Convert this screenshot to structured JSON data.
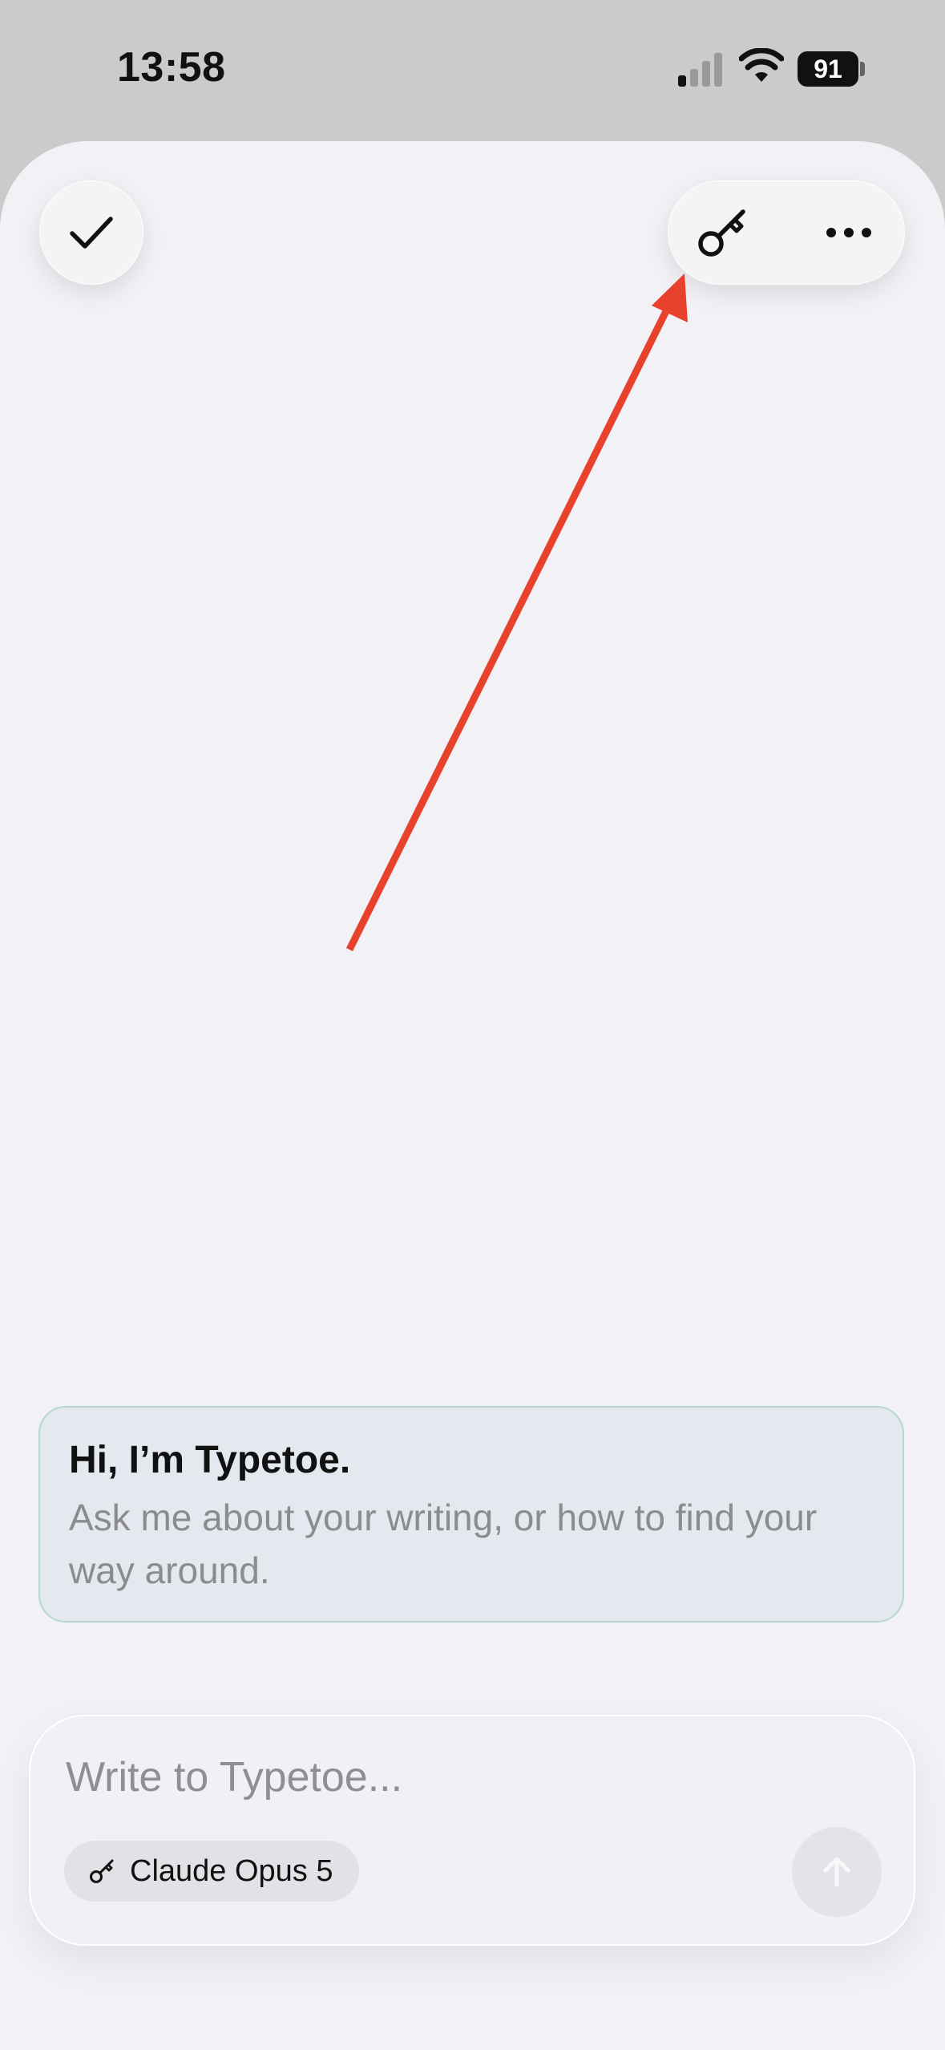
{
  "status_bar": {
    "time": "13:58",
    "battery_level": "91",
    "icons": [
      "signal-icon",
      "wifi-icon",
      "battery-icon"
    ]
  },
  "toolbar": {
    "done_icon": "checkmark-icon",
    "key_icon": "key-icon",
    "more_icon": "ellipsis-icon"
  },
  "annotation": {
    "color": "#e8412c",
    "points_to": "key-button"
  },
  "greeting": {
    "title": "Hi, I’m Typetoe.",
    "body": "Ask me about your writing, or how to find your way around."
  },
  "composer": {
    "placeholder": "Write to Typetoe...",
    "value": "",
    "model_label": "Claude Opus 5",
    "model_icon": "key-icon",
    "send_icon": "arrow-up-icon"
  },
  "colors": {
    "accent_border": "#b6d6d1",
    "greeting_bg": "#e3e9ee",
    "sheet_bg": "#f2f1f5"
  }
}
